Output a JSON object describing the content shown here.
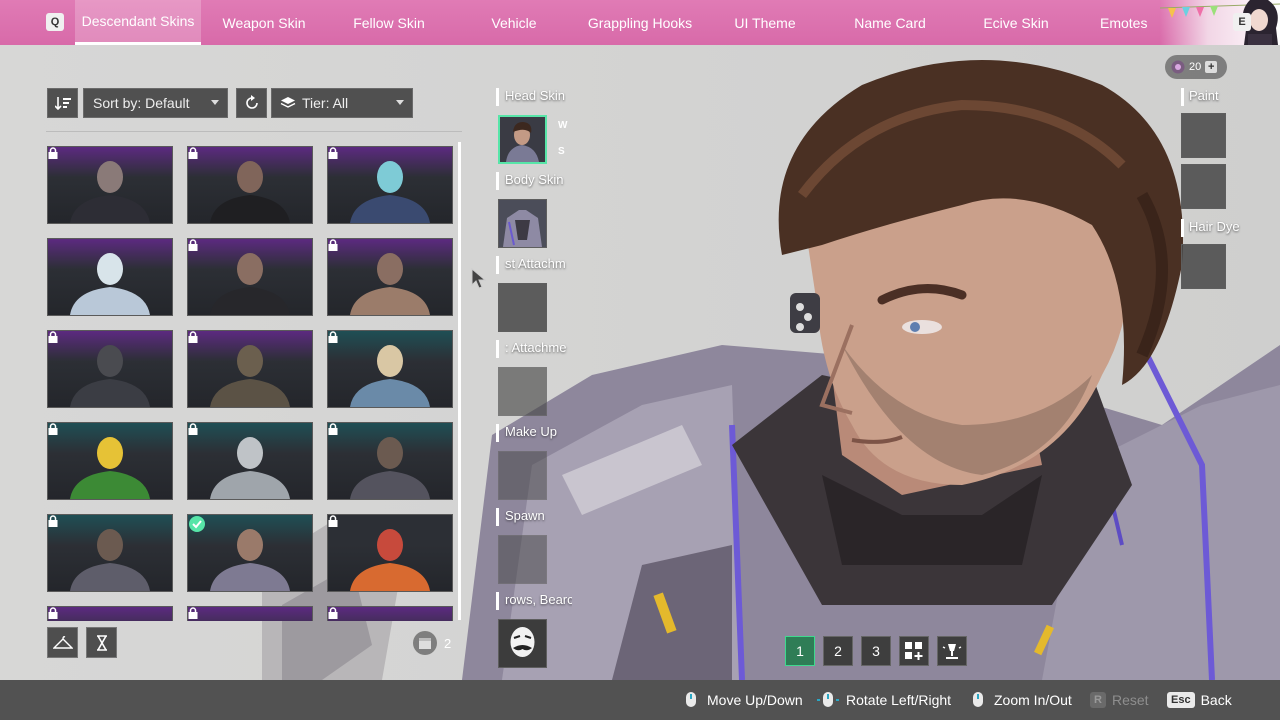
{
  "top_tabs": {
    "key_left": "Q",
    "key_right": "E",
    "items": [
      {
        "label": "Descendant Skins",
        "active": true
      },
      {
        "label": "Weapon Skin"
      },
      {
        "label": "Fellow Skin"
      },
      {
        "label": "Vehicle"
      },
      {
        "label": "Grappling Hooks"
      },
      {
        "label": "UI Theme"
      },
      {
        "label": "Name Card"
      },
      {
        "label": "Ecive Skin"
      },
      {
        "label": "Emotes"
      }
    ]
  },
  "filters": {
    "sort_label": "Sort by: Default",
    "tier_label": "Tier: All"
  },
  "skin_grid": {
    "bg_colors": [
      "#2c2f35",
      "#5c2a80",
      "#1f4f55"
    ]
  },
  "footer_left": {
    "count": "2"
  },
  "slots": {
    "head_skin": "Head Skin",
    "head_key_up": "W",
    "head_key_down": "S",
    "body_skin": "Body Skin",
    "attach_1": "st Attachm",
    "attach_2": ": Attachme",
    "make_up": "Make Up",
    "spawn": "Spawn",
    "brows_beard": "rows, Bearc"
  },
  "right_panel": {
    "currency": "20",
    "paint": "Paint",
    "hair_dye": "Hair Dye"
  },
  "presets": [
    "1",
    "2",
    "3"
  ],
  "bottom_hints": {
    "move": "Move Up/Down",
    "rotate": "Rotate Left/Right",
    "zoom": "Zoom In/Out",
    "reset_key": "R",
    "reset": "Reset",
    "back_key": "Esc",
    "back": "Back"
  },
  "colors": {
    "tab_bar": "#db70ad",
    "equipped_accent": "#57e5a8",
    "preset_active": "#2f7d56"
  }
}
